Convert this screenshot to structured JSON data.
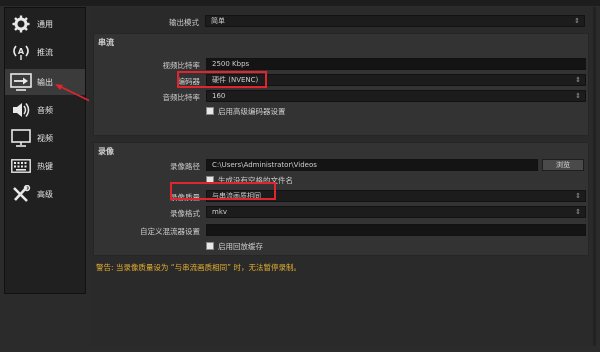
{
  "sidebar": {
    "items": [
      {
        "label": "通用",
        "icon": "gear-icon"
      },
      {
        "label": "推流",
        "icon": "broadcast-icon"
      },
      {
        "label": "输出",
        "icon": "output-icon"
      },
      {
        "label": "音频",
        "icon": "speaker-icon"
      },
      {
        "label": "视频",
        "icon": "monitor-icon"
      },
      {
        "label": "热键",
        "icon": "keyboard-icon"
      },
      {
        "label": "高级",
        "icon": "tools-icon"
      }
    ],
    "selected_index": 2
  },
  "output_mode": {
    "label": "输出模式",
    "value": "简单"
  },
  "streaming": {
    "title": "串流",
    "video_bitrate": {
      "label": "视频比特率",
      "value": "2500 Kbps"
    },
    "encoder": {
      "label": "编码器",
      "value": "硬件 (NVENC)"
    },
    "audio_bitrate": {
      "label": "音频比特率",
      "value": "160"
    },
    "advanced_checkbox": {
      "label": "启用高级编码器设置",
      "checked": false
    }
  },
  "recording": {
    "title": "录像",
    "path": {
      "label": "录像路径",
      "value": "C:\\Users\\Administrator\\Videos",
      "browse_label": "浏览"
    },
    "no_space_checkbox": {
      "label": "生成没有空格的文件名",
      "checked": false
    },
    "quality": {
      "label": "录像质量",
      "value": "与串流画质相同"
    },
    "format": {
      "label": "录像格式",
      "value": "mkv"
    },
    "muxer": {
      "label": "自定义混流器设置",
      "value": ""
    },
    "replay_checkbox": {
      "label": "启用回放缓存",
      "checked": false
    }
  },
  "warning": "警告: 当录像质量设为 “与串流画质相同” 时，无法暂停录制。",
  "colors": {
    "highlight": "#e0252f",
    "warning": "#e5b02f",
    "background": "#2b2b2b"
  }
}
